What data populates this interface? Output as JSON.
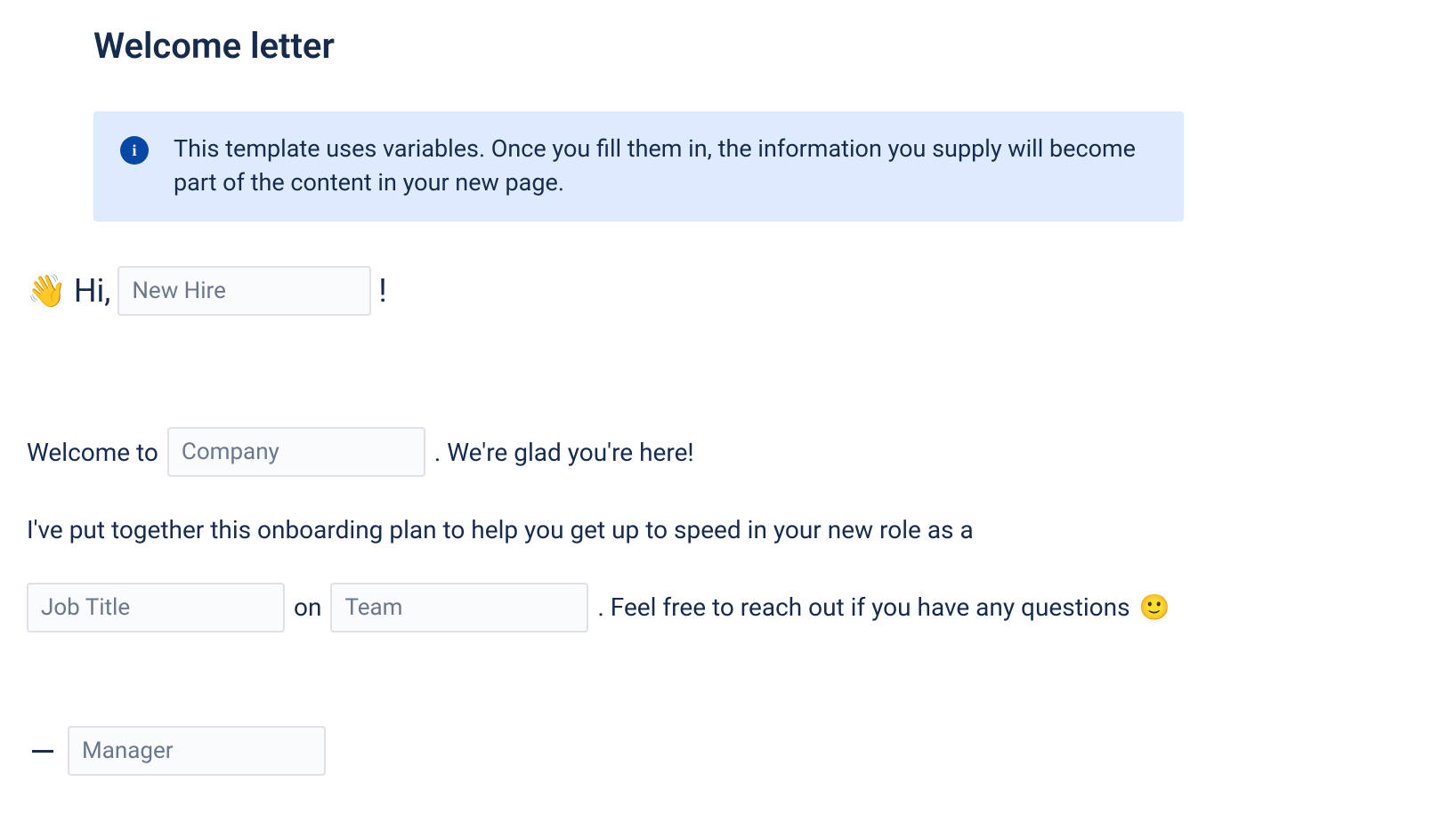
{
  "title": "Welcome letter",
  "info": {
    "text": "This template uses variables. Once you fill them in, the information you supply will become part of the content in your new page."
  },
  "greeting": {
    "wave_emoji": "👋",
    "prefix": "Hi,",
    "suffix": "!",
    "placeholder_new_hire": "New Hire"
  },
  "body": {
    "welcome_prefix": "Welcome to",
    "placeholder_company": "Company",
    "welcome_suffix": ". We're glad you're here!",
    "plan_text": "I've put together this onboarding plan to help you get up to speed in your new role as a",
    "placeholder_job_title": "Job Title",
    "on_text": "on",
    "placeholder_team": "Team",
    "reach_out": ". Feel free to reach out if you have any questions",
    "smile_emoji": "🙂"
  },
  "signature": {
    "placeholder_manager": "Manager"
  }
}
